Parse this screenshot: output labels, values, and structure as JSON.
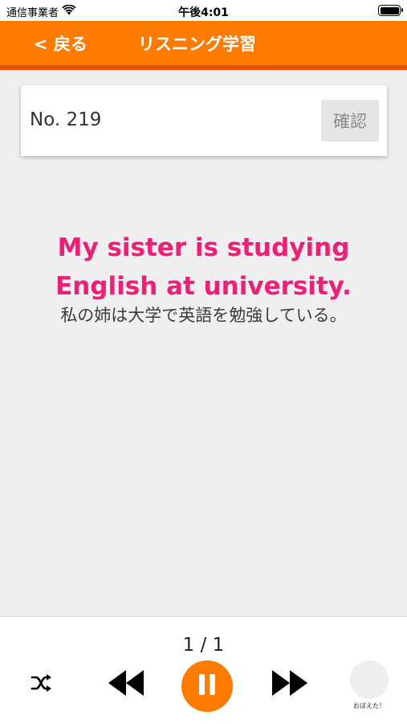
{
  "status_bar": {
    "carrier": "通信事業者",
    "time": "午後4:01",
    "battery_level": 1.0
  },
  "nav": {
    "back_label": "< 戻る",
    "title": "リスニング学習"
  },
  "card": {
    "number_label": "No. 219",
    "confirm_label": "確認"
  },
  "sentence": {
    "english_line1": "My sister is studying",
    "english_line2": "English at university.",
    "japanese": "私の姉は大学で英語を勉強している。"
  },
  "player": {
    "page_count": "1 / 1",
    "memorized_label": "おぼえた！"
  },
  "colors": {
    "accent": "#ff7a00",
    "accent_dark": "#e65000",
    "english_text": "#ee1f74"
  },
  "icons": [
    "wifi-icon",
    "battery-icon",
    "shuffle-icon",
    "rewind-icon",
    "pause-icon",
    "fast-forward-icon"
  ]
}
